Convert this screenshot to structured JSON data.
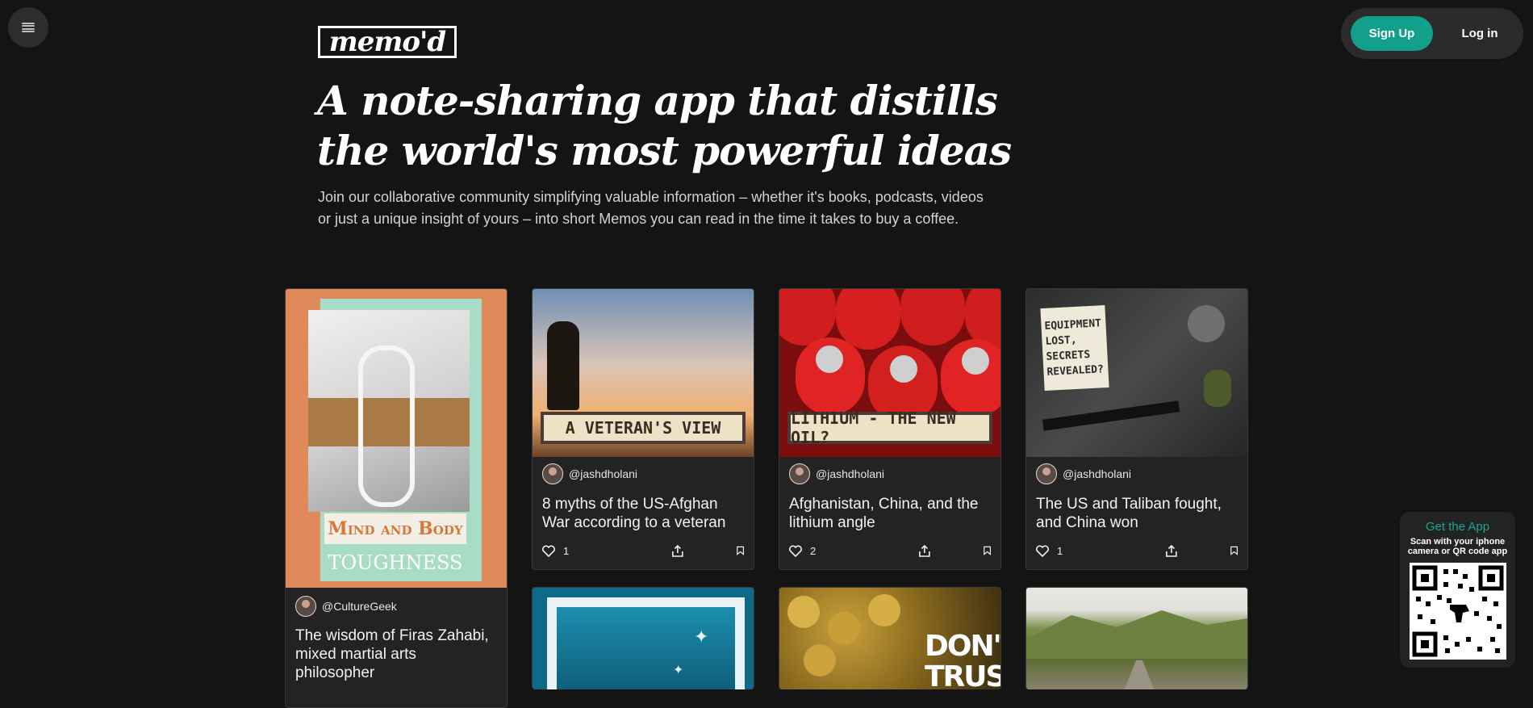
{
  "header": {
    "logo_text": "memo'd",
    "signup_label": "Sign Up",
    "login_label": "Log in"
  },
  "hero": {
    "headline": "A note-sharing app that distills the world's most powerful ideas",
    "subtext": "Join our collaborative community simplifying valuable information – whether it's books, podcasts, videos or just a unique insight of yours – into short Memos you can read in the time it takes to buy a coffee."
  },
  "cards": [
    {
      "author": "@CultureGeek",
      "title": "The wisdom of Firas Zahabi, mixed martial arts philosopher",
      "thumb_text_1": "Mind and Body",
      "thumb_text_2": "TOUGHNESS"
    },
    {
      "author": "@jashdholani",
      "title": "8 myths of the US-Afghan War according to a veteran",
      "likes": "1",
      "thumb_text": "A VETERAN'S VIEW"
    },
    {
      "author": "@jashdholani",
      "title": "Afghanistan, China, and the lithium angle",
      "likes": "2",
      "thumb_text": "LITHIUM - THE NEW OIL?"
    },
    {
      "author": "@jashdholani",
      "title": "The US and Taliban fought, and China won",
      "likes": "1",
      "thumb_text": "EQUIPMENT LOST, SECRETS REVEALED?"
    },
    {
      "thumb_text": "DON'T TRUST"
    }
  ],
  "app_promo": {
    "title": "Get the App",
    "subtitle": "Scan with your iphone camera or QR code app"
  },
  "colors": {
    "background": "#141414",
    "accent": "#12a08d",
    "card": "#232323"
  }
}
